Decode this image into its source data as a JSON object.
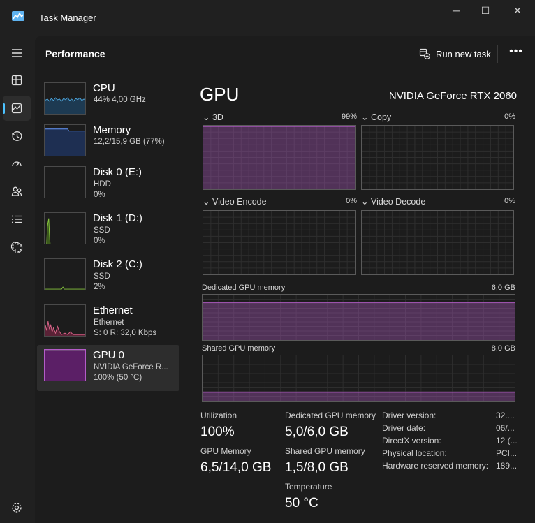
{
  "window": {
    "title": "Task Manager",
    "minimize_glyph": "─",
    "maximize_glyph": "☐",
    "close_glyph": "✕"
  },
  "header": {
    "title": "Performance",
    "run_task_label": "Run new task",
    "more_glyph": "•••"
  },
  "rail": {
    "items": [
      "hamburger-icon",
      "processes-icon",
      "performance-icon",
      "app-history-icon",
      "startup-apps-icon",
      "users-icon",
      "details-icon",
      "services-icon",
      "settings-icon"
    ],
    "active": "performance-icon",
    "accent": "#4cc2ff"
  },
  "devices": [
    {
      "name": "CPU",
      "line1": "44%  4,00 GHz",
      "line2": "",
      "color": "#4ca3d9"
    },
    {
      "name": "Memory",
      "line1": "12,2/15,9 GB (77%)",
      "line2": "",
      "color": "#6699ff"
    },
    {
      "name": "Disk 0 (E:)",
      "line1": "HDD",
      "line2": "0%",
      "color": "#86c53c"
    },
    {
      "name": "Disk 1 (D:)",
      "line1": "SSD",
      "line2": "0%",
      "color": "#86c53c"
    },
    {
      "name": "Disk 2 (C:)",
      "line1": "SSD",
      "line2": "2%",
      "color": "#86c53c"
    },
    {
      "name": "Ethernet",
      "line1": "Ethernet",
      "line2": "S: 0  R: 32,0 Kbps",
      "color": "#d9668a"
    },
    {
      "name": "GPU 0",
      "line1": "NVIDIA GeForce R...",
      "line2": "100%  (50 °C)",
      "color": "#b45cc8"
    }
  ],
  "gpu": {
    "title": "GPU",
    "model": "NVIDIA GeForce RTX 2060",
    "accent": "#b45cc8",
    "engines": [
      {
        "label": "3D",
        "percent": "99%",
        "fill": 0.99
      },
      {
        "label": "Copy",
        "percent": "0%",
        "fill": 0
      },
      {
        "label": "Video Encode",
        "percent": "0%",
        "fill": 0
      },
      {
        "label": "Video Decode",
        "percent": "0%",
        "fill": 0
      }
    ],
    "dedicated": {
      "label": "Dedicated GPU memory",
      "max": "6,0 GB",
      "fill": 0.83
    },
    "shared": {
      "label": "Shared GPU memory",
      "max": "8,0 GB",
      "fill": 0.19
    },
    "stats": {
      "utilization_label": "Utilization",
      "utilization": "100%",
      "dedicated_label": "Dedicated GPU memory",
      "dedicated": "5,0/6,0 GB",
      "gpu_memory_label": "GPU Memory",
      "gpu_memory": "6,5/14,0 GB",
      "shared_label": "Shared GPU memory",
      "shared": "1,5/8,0 GB",
      "temperature_label": "Temperature",
      "temperature": "50 °C"
    },
    "info": [
      {
        "key": "Driver version:",
        "value": "32...."
      },
      {
        "key": "Driver date:",
        "value": "06/..."
      },
      {
        "key": "DirectX version:",
        "value": "12 (..."
      },
      {
        "key": "Physical location:",
        "value": "PCI..."
      },
      {
        "key": "Hardware reserved memory:",
        "value": "189..."
      }
    ]
  }
}
